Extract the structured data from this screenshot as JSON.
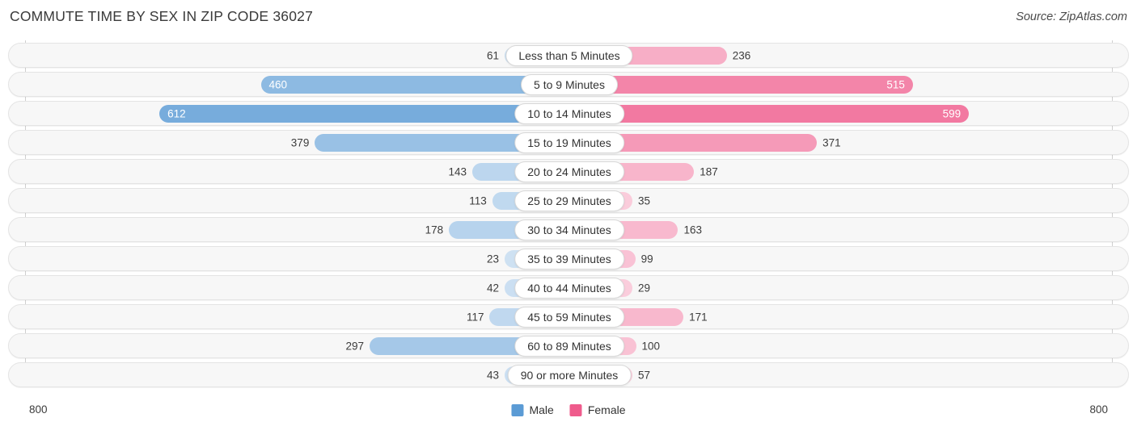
{
  "header": {
    "title": "COMMUTE TIME BY SEX IN ZIP CODE 36027",
    "source": "Source: ZipAtlas.com"
  },
  "axis": {
    "left_label": "800",
    "right_label": "800"
  },
  "legend": {
    "male_label": "Male",
    "female_label": "Female",
    "male_color": "#5b9bd5",
    "female_color": "#ef5b8c"
  },
  "chart_data": {
    "type": "bar",
    "title": "Commute Time by Sex in Zip Code 36027",
    "subtitle": "Source: ZipAtlas.com",
    "orientation": "horizontal-diverging",
    "xlabel": "",
    "ylabel": "",
    "xlim": [
      800,
      800
    ],
    "axis_max": 800,
    "grid": false,
    "legend_position": "bottom-center",
    "categories": [
      "Less than 5 Minutes",
      "5 to 9 Minutes",
      "10 to 14 Minutes",
      "15 to 19 Minutes",
      "20 to 24 Minutes",
      "25 to 29 Minutes",
      "30 to 34 Minutes",
      "35 to 39 Minutes",
      "40 to 44 Minutes",
      "45 to 59 Minutes",
      "60 to 89 Minutes",
      "90 or more Minutes"
    ],
    "series": [
      {
        "name": "Male",
        "color": "#5b9bd5",
        "direction": "left",
        "values": [
          61,
          460,
          612,
          379,
          143,
          113,
          178,
          23,
          42,
          117,
          297,
          43
        ]
      },
      {
        "name": "Female",
        "color": "#ef5b8c",
        "direction": "right",
        "values": [
          236,
          515,
          599,
          371,
          187,
          35,
          163,
          99,
          29,
          171,
          100,
          57
        ]
      }
    ]
  }
}
